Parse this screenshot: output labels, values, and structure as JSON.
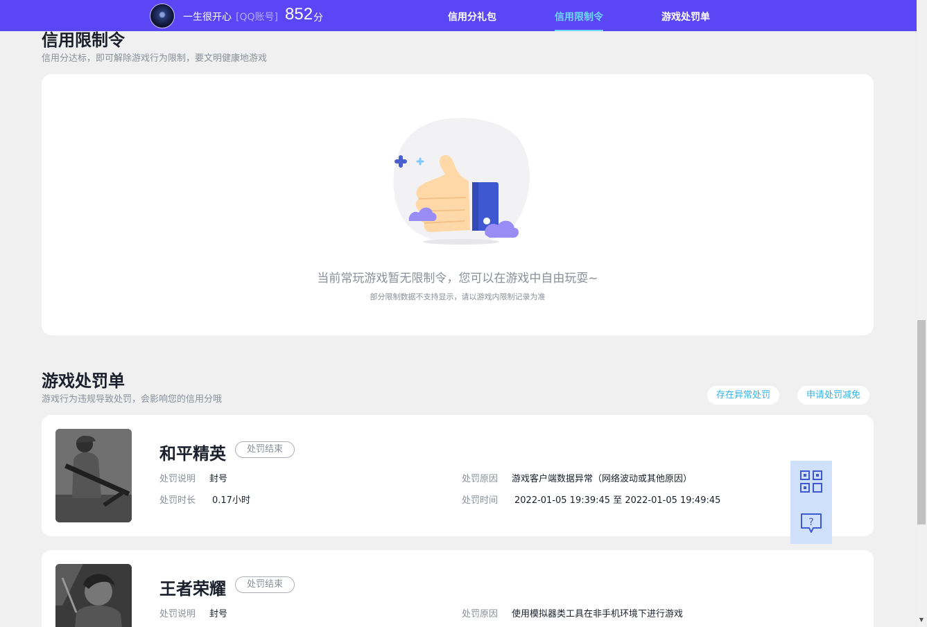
{
  "header": {
    "username": "一生很开心",
    "account_type": "[QQ账号]",
    "score": "852",
    "score_unit": "分",
    "nav": [
      {
        "label": "信用分礼包"
      },
      {
        "label": "信用限制令"
      },
      {
        "label": "游戏处罚单"
      }
    ],
    "active_tab": "信用限制令",
    "accent_color": "#5a46f5",
    "active_color": "#6fd6ff"
  },
  "restriction_section": {
    "title": "信用限制令",
    "subtitle": "信用分达标，即可解除游戏行为限制，要文明健康地游戏",
    "empty_title": "当前常玩游戏暂无限制令，您可以在游戏中自由玩耍~",
    "empty_subtitle": "部分限制数据不支持显示，请以游戏内限制记录为准",
    "empty_icon": "thumbs-up-illustration"
  },
  "penalty_section": {
    "title": "游戏处罚单",
    "subtitle": "游戏行为违规导致处罚，会影响您的信用分哦",
    "buttons": {
      "abnormal": "存在异常处罚",
      "reduce": "申请处罚减免"
    },
    "items": [
      {
        "game": "和平精英",
        "status": "处罚结束",
        "desc_label": "处罚说明",
        "desc": "封号",
        "duration_label": "处罚时长",
        "duration": "0.17小时",
        "reason_label": "处罚原因",
        "reason": "游戏客户端数据异常（网络波动或其他原因）",
        "time_label": "处罚时间",
        "time": "2022-01-05 19:39:45 至 2022-01-05 19:49:45"
      },
      {
        "game": "王者荣耀",
        "status": "处罚结束",
        "desc_label": "处罚说明",
        "desc": "封号",
        "reason_label": "处罚原因",
        "reason": "使用模拟器类工具在非手机环境下进行游戏"
      }
    ]
  },
  "float_panel": {
    "qr_icon": "qr-code-icon",
    "help_icon": "help-chat-icon"
  }
}
